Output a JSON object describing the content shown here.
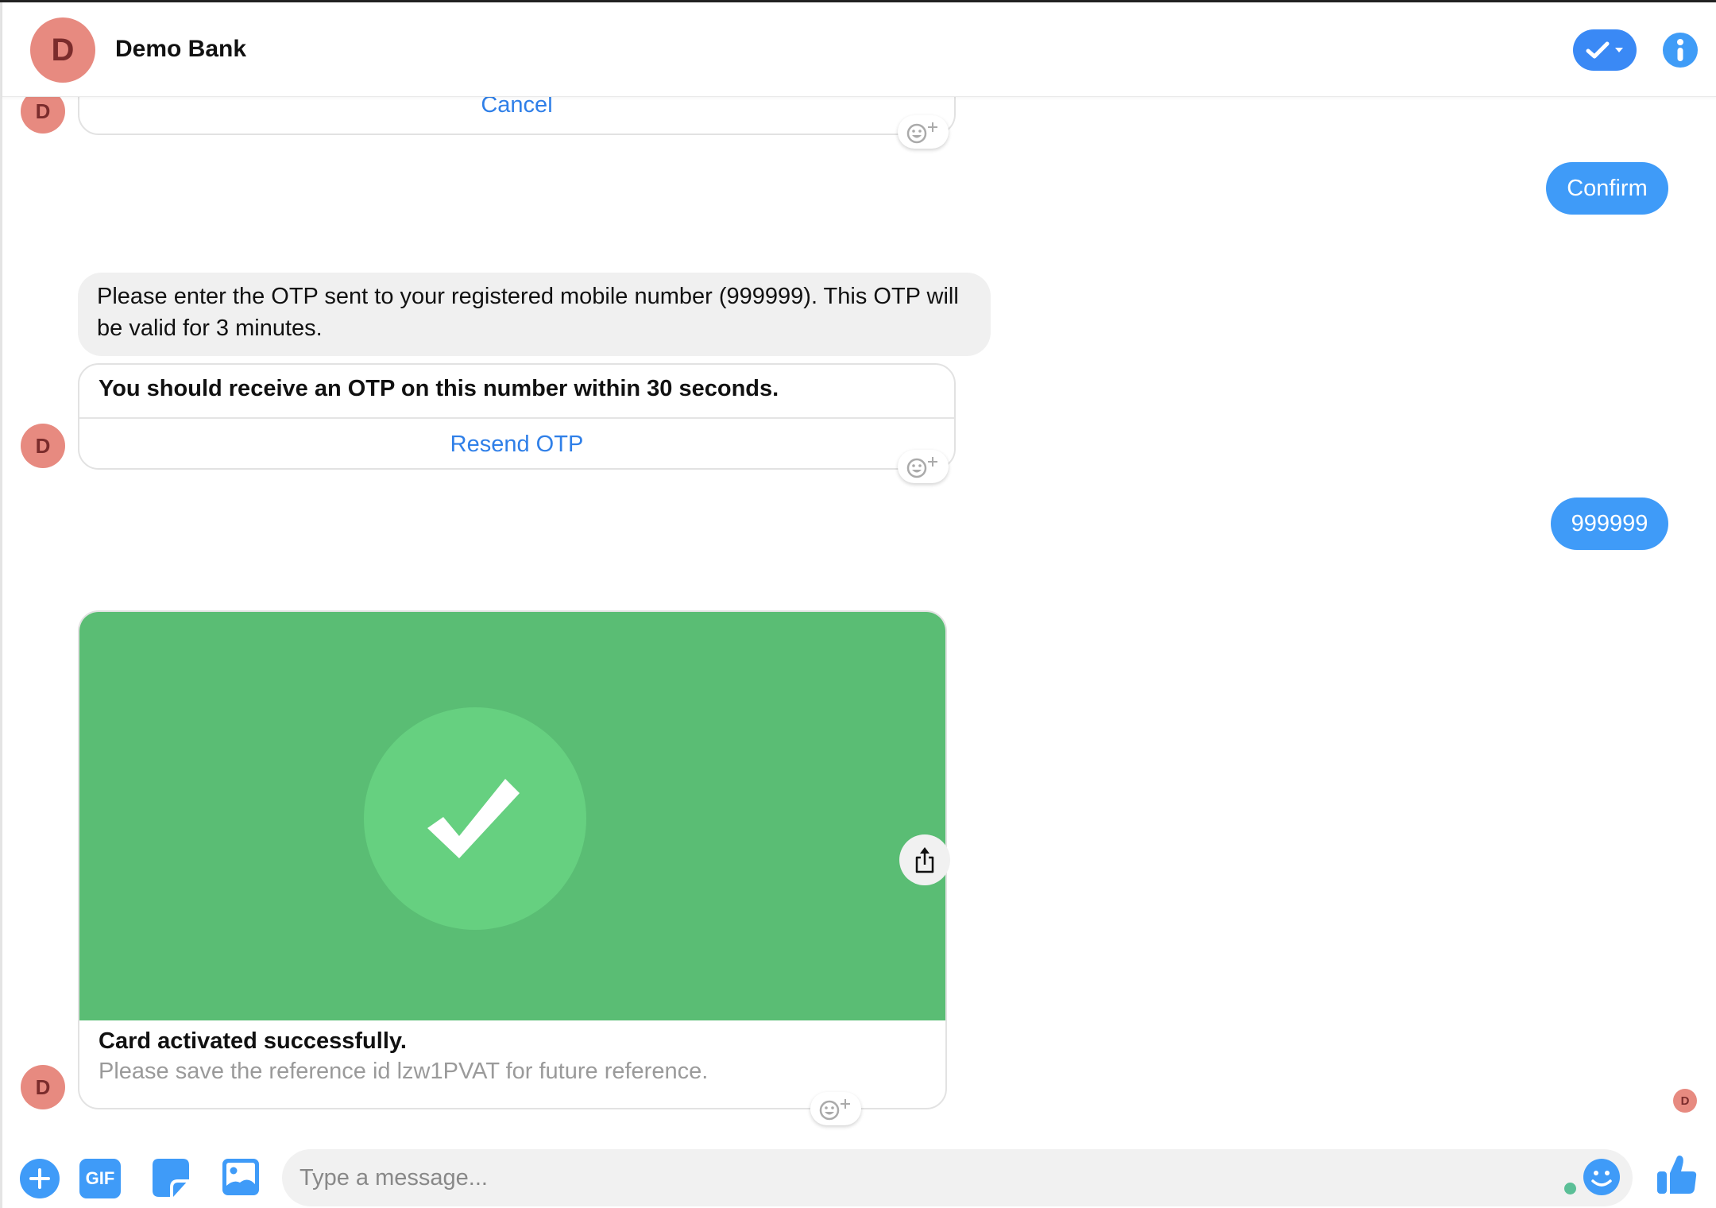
{
  "header": {
    "avatar_letter": "D",
    "title": "Demo Bank",
    "check_button_icon": "check-dropdown-icon",
    "info_button_icon": "info-icon"
  },
  "avatar_letter": "D",
  "messages": {
    "cancel_card": {
      "button_label": "Cancel"
    },
    "confirm_reply": {
      "text": "Confirm"
    },
    "otp_prompt": {
      "text": "Please enter the OTP sent to your registered mobile number (999999). This OTP will be valid for 3 minutes."
    },
    "otp_card": {
      "title": "You should receive an OTP on this number within 30 seconds.",
      "button_label": "Resend OTP"
    },
    "otp_reply": {
      "text": "999999"
    },
    "success_card": {
      "image_icon": "checkmark-icon",
      "title": "Card activated successfully.",
      "subtitle": "Please save the reference id lzw1PVAT for future reference."
    }
  },
  "read_receipt_letter": "D",
  "composer": {
    "placeholder": "Type a message...",
    "value": "",
    "gif_label": "GIF"
  },
  "colors": {
    "accent_blue": "#3f9bf8",
    "avatar_bg": "#e78a80",
    "avatar_fg": "#7b2c2c",
    "success_green": "#5abd74",
    "success_circle": "#66d080",
    "online_dot": "#5bbf97"
  }
}
